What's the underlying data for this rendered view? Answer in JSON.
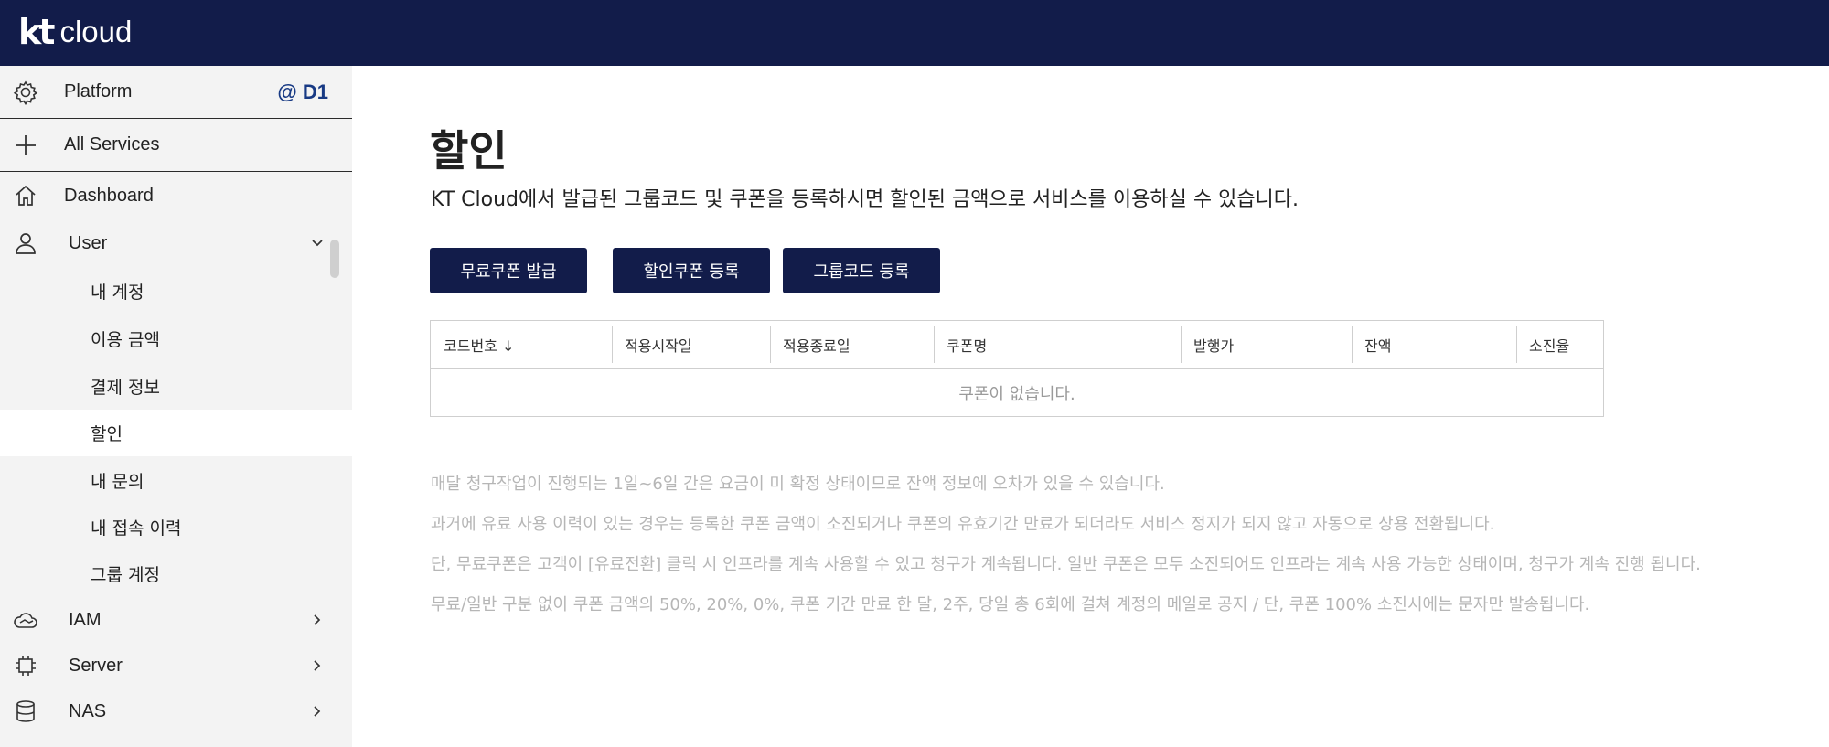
{
  "header": {
    "logo_kt": "kt",
    "logo_cloud": "cloud"
  },
  "sidebar": {
    "platform_label": "Platform",
    "platform_badge": "@ D1",
    "all_services": "All Services",
    "items": [
      {
        "label": "Dashboard",
        "icon": "home-icon"
      },
      {
        "label": "User",
        "icon": "user-icon",
        "expanded": true
      },
      {
        "label": "내 계정"
      },
      {
        "label": "이용 금액"
      },
      {
        "label": "결제 정보"
      },
      {
        "label": "할인",
        "active": true
      },
      {
        "label": "내 문의"
      },
      {
        "label": "내 접속 이력"
      },
      {
        "label": "그룹 계정"
      },
      {
        "label": "IAM",
        "icon": "cloud-icon"
      },
      {
        "label": "Server",
        "icon": "chip-icon"
      },
      {
        "label": "NAS",
        "icon": "database-icon"
      }
    ]
  },
  "page": {
    "title": "할인",
    "subtitle": "KT Cloud에서 발급된 그룹코드 및 쿠폰을 등록하시면 할인된 금액으로 서비스를 이용하실 수 있습니다.",
    "buttons": {
      "free_coupon": "무료쿠폰 발급",
      "discount_coupon": "할인쿠폰 등록",
      "group_code": "그룹코드 등록"
    },
    "table": {
      "columns": [
        "코드번호 ↓",
        "적용시작일",
        "적용종료일",
        "쿠폰명",
        "발행가",
        "잔액",
        "소진율"
      ],
      "empty_text": "쿠폰이 없습니다."
    },
    "notes": [
      "매달 청구작업이 진행되는 1일~6일 간은 요금이 미 확정 상태이므로 잔액 정보에 오차가 있을 수 있습니다.",
      "과거에 유료 사용 이력이 있는 경우는 등록한 쿠폰 금액이 소진되거나 쿠폰의 유효기간 만료가 되더라도 서비스 정지가 되지 않고 자동으로 상용 전환됩니다.",
      "단, 무료쿠폰은 고객이 [유료전환] 클릭 시 인프라를 계속 사용할 수 있고 청구가 계속됩니다. 일반 쿠폰은 모두 소진되어도 인프라는 계속 사용 가능한 상태이며, 청구가 계속 진행 됩니다.",
      "무료/일반 구분 없이 쿠폰 금액의 50%, 20%, 0%, 쿠폰 기간 만료 한 달, 2주, 당일 총 6회에 걸쳐 계정의 메일로 공지 / 단, 쿠폰 100% 소진시에는 문자만 발송됩니다."
    ]
  },
  "colors": {
    "navy": "#121c4a",
    "badge": "#183a84",
    "sidebar_bg": "#f3f3f3",
    "note_text": "#b6b6b6"
  }
}
